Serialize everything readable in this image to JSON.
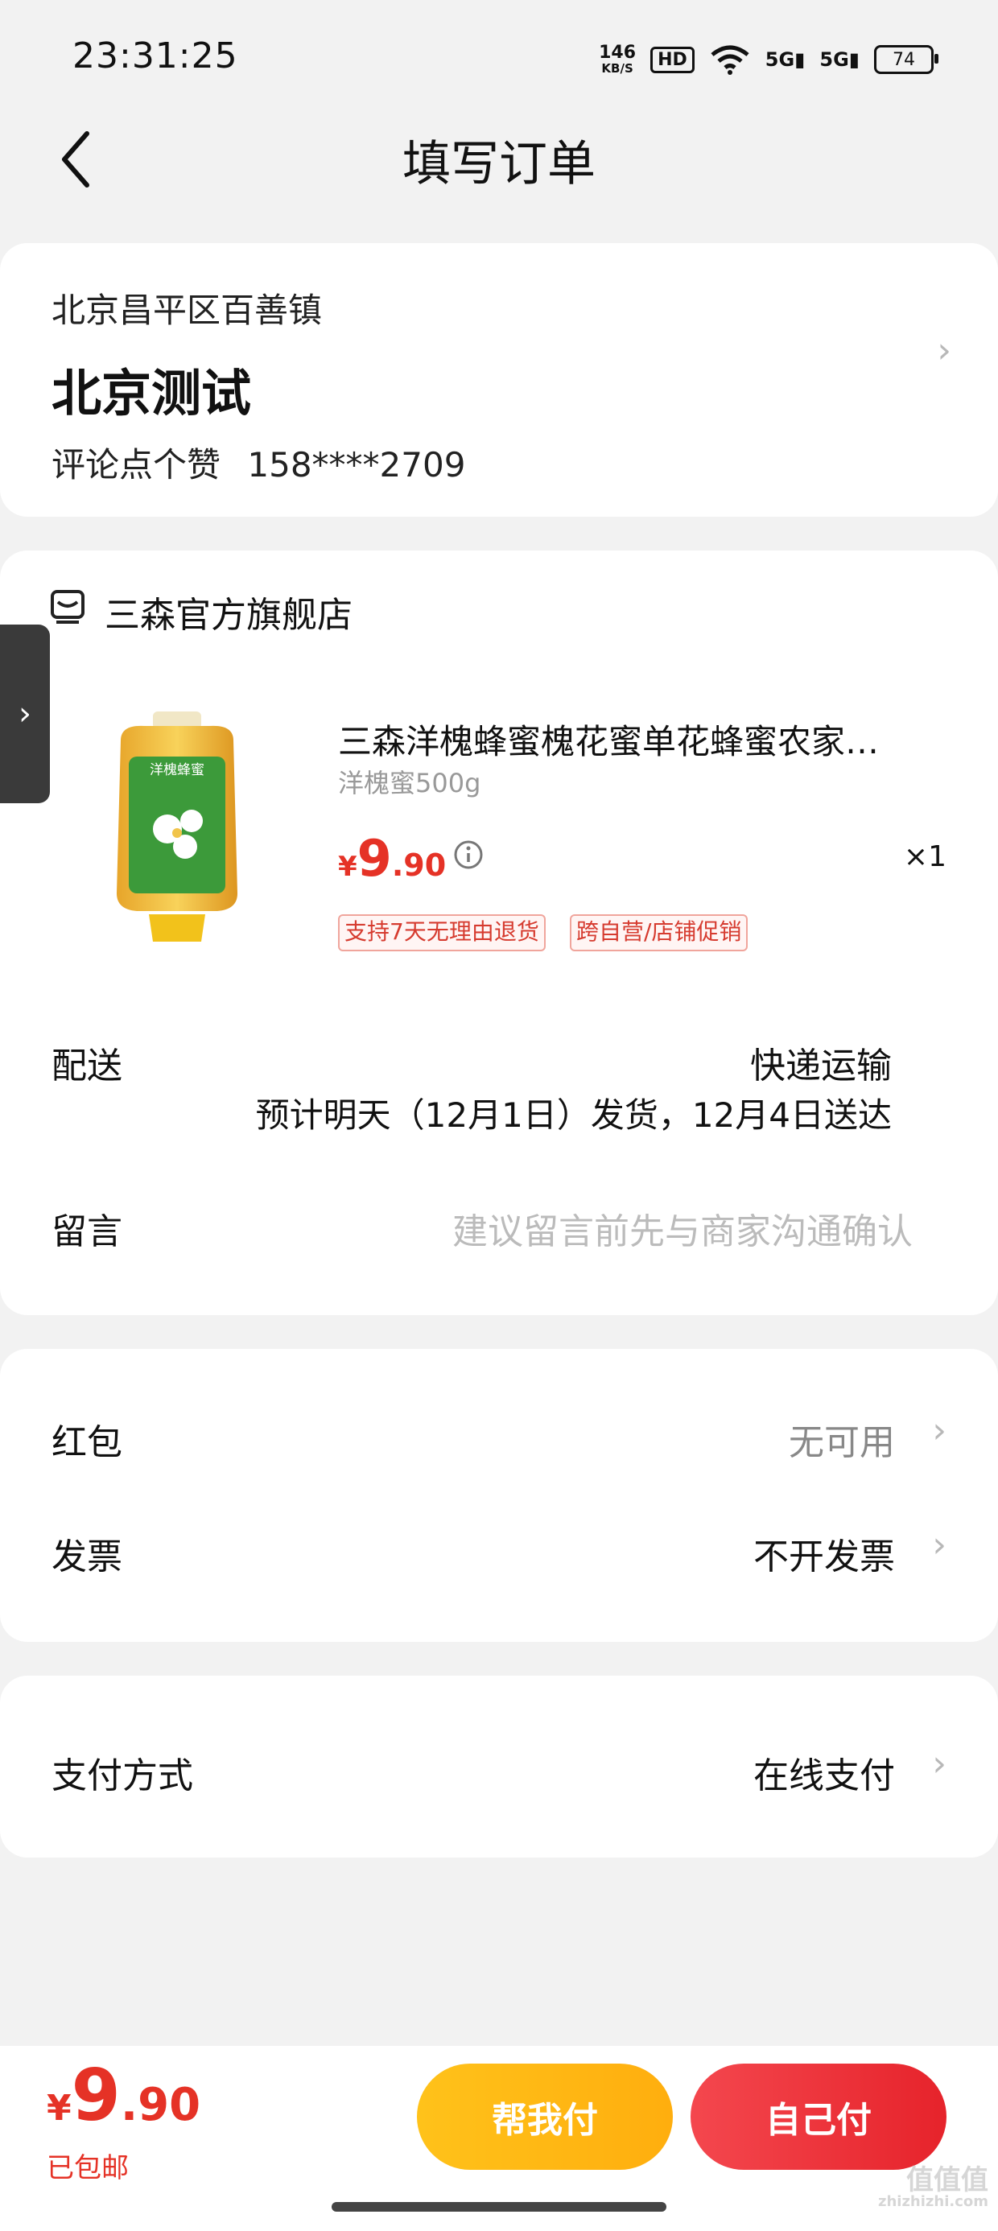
{
  "status_bar": {
    "time": "23:31:25",
    "speed_value": "146",
    "speed_unit": "KB/S",
    "hd": "HD",
    "signal1": "5G",
    "signal2": "5G",
    "battery": "74"
  },
  "nav": {
    "title": "填写订单"
  },
  "address": {
    "region": "北京昌平区百善镇",
    "name": "北京测试",
    "contact_name": "评论点个赞",
    "phone": "158****2709"
  },
  "store": {
    "name": "三森官方旗舰店"
  },
  "product": {
    "title": "三森洋槐蜂蜜槐花蜜单花蜂蜜农家…",
    "spec": "洋槐蜜500g",
    "price_currency": "¥",
    "price_int": "9",
    "price_dec": ".90",
    "quantity": "×1",
    "tags": [
      "支持7天无理由退货",
      "跨自营/店铺促销"
    ],
    "image_label": "洋槐蜂蜜"
  },
  "shipping": {
    "label": "配送",
    "method": "快递运输",
    "eta": "预计明天（12月1日）发货，12月4日送达"
  },
  "memo": {
    "label": "留言",
    "placeholder": "建议留言前先与商家沟通确认"
  },
  "red_packet": {
    "label": "红包",
    "value": "无可用"
  },
  "invoice": {
    "label": "发票",
    "value": "不开发票"
  },
  "payment": {
    "label": "支付方式",
    "value": "在线支付"
  },
  "bottom": {
    "currency": "¥",
    "total_int": "9",
    "total_dec": ".90",
    "shipping_note": "已包邮",
    "help_pay_label": "帮我付",
    "self_pay_label": "自己付"
  },
  "watermark": {
    "main": "值值值",
    "sub": "zhizhizhi.com"
  },
  "colors": {
    "accent_red": "#e53226",
    "button_yellow": "#ffb814",
    "button_red": "#ec2f36"
  }
}
